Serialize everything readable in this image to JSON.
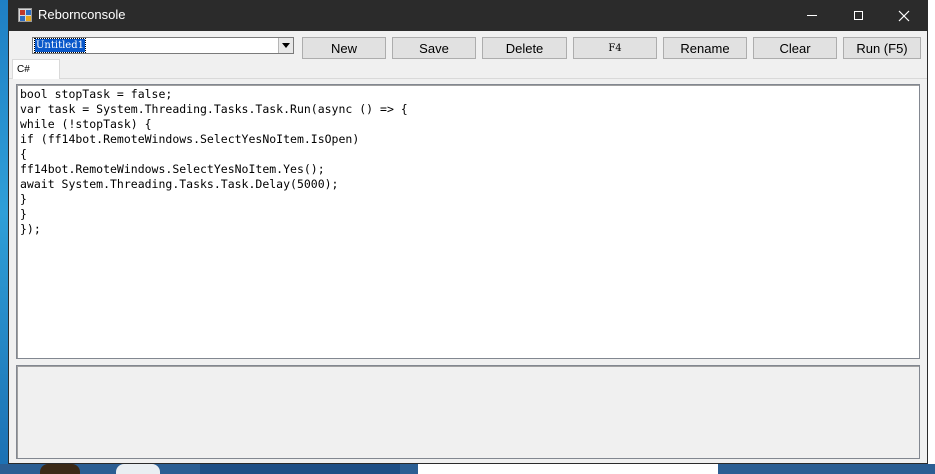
{
  "window": {
    "title": "Rebornconsole",
    "icon": "app-grid-icon"
  },
  "toolbar": {
    "script_name": "Untitled1",
    "buttons": {
      "new": "New",
      "save": "Save",
      "delete": "Delete",
      "f4": "F4",
      "rename": "Rename",
      "clear": "Clear",
      "run": "Run (F5)"
    }
  },
  "tabs": [
    {
      "label": "C#",
      "selected": true
    }
  ],
  "editor": {
    "lines": [
      "bool stopTask = false;",
      "var task = System.Threading.Tasks.Task.Run(async () => {",
      "while (!stopTask) {",
      "if (ff14bot.RemoteWindows.SelectYesNoItem.IsOpen)",
      "{",
      "ff14bot.RemoteWindows.SelectYesNoItem.Yes();",
      "await System.Threading.Tasks.Task.Delay(5000);",
      "}",
      "}",
      "});"
    ]
  },
  "output": {
    "text": ""
  }
}
